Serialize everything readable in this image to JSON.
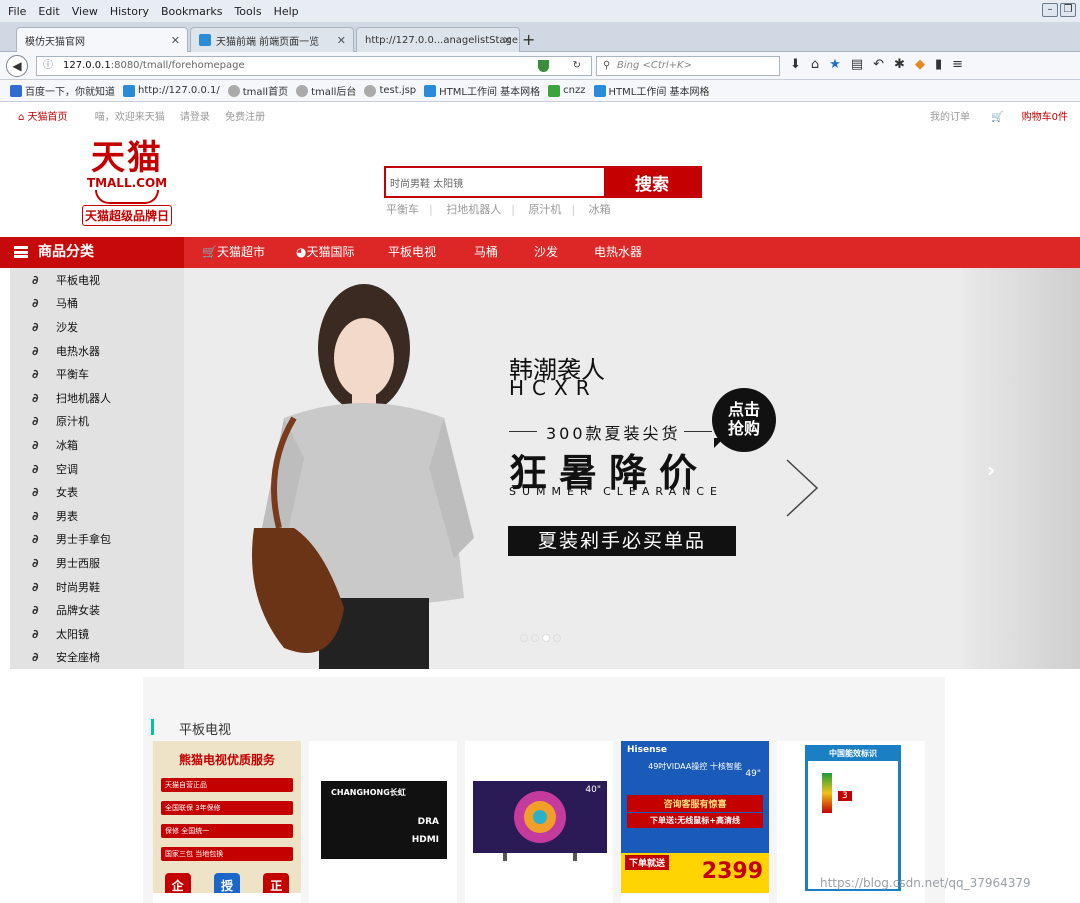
{
  "browser": {
    "menu": [
      "File",
      "Edit",
      "View",
      "History",
      "Bookmarks",
      "Tools",
      "Help"
    ],
    "tabs": [
      {
        "label": "模仿天猫官网",
        "active": true
      },
      {
        "label": "天猫前端 前端页面一览",
        "active": false
      },
      {
        "label": "http://127.0.0...anagelistStage",
        "active": false
      }
    ],
    "url_host": "127.0.0.1",
    "url_rest": ":8080/tmall/forehomepage",
    "search_placeholder": "Bing <Ctrl+K>",
    "bookmarks": [
      {
        "label": "百度一下，你就知道",
        "color": "#2f6ccf"
      },
      {
        "label": "http://127.0.0.1/",
        "color": "#2a8bd8"
      },
      {
        "label": "tmall首页",
        "color": "#888"
      },
      {
        "label": "tmall后台",
        "color": "#888"
      },
      {
        "label": "test.jsp",
        "color": "#888"
      },
      {
        "label": "HTML工作间 基本网格",
        "color": "#2a8bd8"
      },
      {
        "label": "cnzz",
        "color": "#3aa53a"
      },
      {
        "label": "HTML工作间 基本网格",
        "color": "#2a8bd8"
      }
    ]
  },
  "page": {
    "topbar": {
      "home": "天猫首页",
      "greeting": "喵，欢迎来天猫",
      "login": "请登录",
      "register": "免费注册",
      "orders": "我的订单",
      "cart": "购物车0件"
    },
    "logo": {
      "big": "天猫",
      "en": "TMALL.COM",
      "slogan": "天猫超级品牌日"
    },
    "search": {
      "value": "时尚男鞋 太阳镜",
      "button": "搜索",
      "hotwords": [
        "平衡车",
        "扫地机器人",
        "原汁机",
        "冰箱"
      ]
    },
    "catnav": {
      "head": "商品分类",
      "links": [
        "天猫超市",
        "天猫国际",
        "平板电视",
        "马桶",
        "沙发",
        "电热水器"
      ]
    },
    "categories": [
      "平板电视",
      "马桶",
      "沙发",
      "电热水器",
      "平衡车",
      "扫地机器人",
      "原汁机",
      "冰箱",
      "空调",
      "女表",
      "男表",
      "男士手拿包",
      "男士西服",
      "时尚男鞋",
      "品牌女装",
      "太阳镜",
      "安全座椅"
    ],
    "banner": {
      "title": "韩潮袭人",
      "hcxr": "HCXR",
      "sub": "300款夏装尖货",
      "main": "狂暑降价",
      "summer": "SUMMER CLEARANCE",
      "bar": "夏装剁手必买单品",
      "bubble1": "点击",
      "bubble2": "抢购"
    },
    "section_title": "平板电视",
    "products": [
      {
        "top": "熊猫电视优质服务",
        "r1": "天猫自营正品",
        "r2": "全国联保 3年保修",
        "r3": "保修 全国统一",
        "r4": "国家三包 当地包换",
        "b1": "企",
        "b2": "授",
        "b3": "正"
      },
      {
        "brand": "CHANGHONG长虹",
        "hdmi": "HDMI",
        "dra": "DRA"
      },
      {
        "size": "40\""
      },
      {
        "brand": "Hisense",
        "line1": "49吋VIDAA操控 十核智能",
        "size": "49\"",
        "promo1": "咨询客服有惊喜",
        "promo2": "下单送:无线鼠标+高清线",
        "price": "2399",
        "sticker": "下单就送"
      },
      {
        "title": "中国能效标识",
        "grade": "3"
      }
    ],
    "watermark": "https://blog.csdn.net/qq_37964379"
  }
}
